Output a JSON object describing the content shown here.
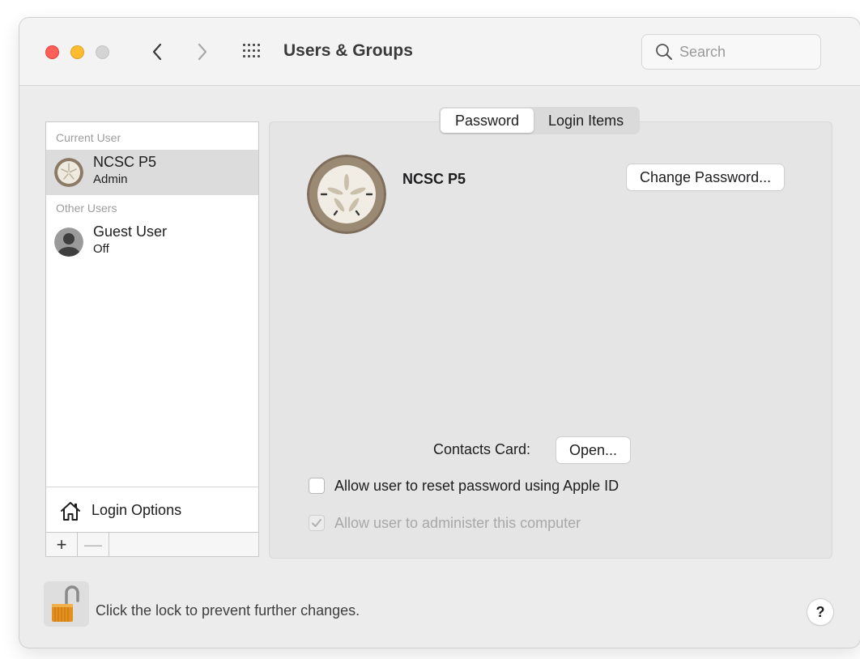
{
  "window": {
    "title": "Users & Groups",
    "traffic_colors": {
      "close": "#fe5f57",
      "minimize": "#febc2e",
      "maximize": "#d4d4d4"
    }
  },
  "toolbar": {
    "back_icon": "chevron-left-icon",
    "forward_icon": "chevron-right-icon",
    "show_all_icon": "grid-icon",
    "search": {
      "placeholder": "Search",
      "value": ""
    }
  },
  "sidebar": {
    "current_user_label": "Current User",
    "other_users_label": "Other Users",
    "users": [
      {
        "name": "NCSC P5",
        "role": "Admin",
        "selected": true,
        "avatar_icon": "sand-dollar-icon"
      },
      {
        "name": "Guest User",
        "role": "Off",
        "selected": false,
        "avatar_icon": "person-silhouette-icon"
      }
    ],
    "login_options_label": "Login Options",
    "add_label": "+",
    "remove_label": "—"
  },
  "tabs": [
    {
      "label": "Password",
      "active": true
    },
    {
      "label": "Login Items",
      "active": false
    }
  ],
  "detail": {
    "user_name": "NCSC P5",
    "change_password_label": "Change Password...",
    "contacts_card_label": "Contacts Card:",
    "open_label": "Open...",
    "allow_reset_label": "Allow user to reset password using Apple ID",
    "allow_reset_checked": false,
    "allow_admin_label": "Allow user to administer this computer",
    "allow_admin_checked": true,
    "allow_admin_enabled": false
  },
  "footer": {
    "lock_text": "Click the lock to prevent further changes.",
    "lock_icon": "padlock-open-icon",
    "help_label": "?"
  },
  "colors": {
    "window_bg": "#ececec",
    "selection_bg": "#dcdcdc",
    "panel_bg": "#e5e5e5"
  }
}
